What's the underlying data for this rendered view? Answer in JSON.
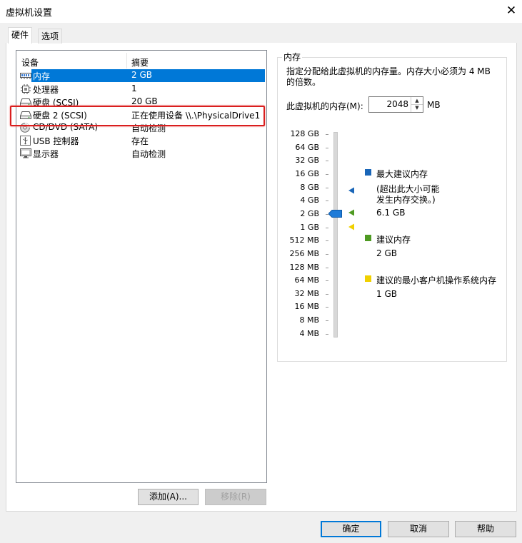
{
  "window": {
    "title": "虚拟机设置",
    "close_glyph": "✕"
  },
  "tabs": [
    {
      "label": "硬件",
      "active": true
    },
    {
      "label": "选项",
      "active": false
    }
  ],
  "device_list": {
    "col_device": "设备",
    "col_summary": "摘要",
    "rows": [
      {
        "icon": "memory-icon",
        "name": "内存",
        "summary": "2 GB",
        "selected": true
      },
      {
        "icon": "processor-icon",
        "name": "处理器",
        "summary": "1",
        "selected": false
      },
      {
        "icon": "hard-disk-icon",
        "name": "硬盘 (SCSI)",
        "summary": "20 GB",
        "selected": false
      },
      {
        "icon": "hard-disk-icon",
        "name": "硬盘 2 (SCSI)",
        "summary": "正在使用设备 \\\\.\\PhysicalDrive1",
        "selected": false,
        "highlighted": true
      },
      {
        "icon": "cd-dvd-icon",
        "name": "CD/DVD (SATA)",
        "summary": "自动检测",
        "selected": false
      },
      {
        "icon": "usb-icon",
        "name": "USB 控制器",
        "summary": "存在",
        "selected": false
      },
      {
        "icon": "display-icon",
        "name": "显示器",
        "summary": "自动检测",
        "selected": false
      }
    ]
  },
  "buttons": {
    "add": "添加(A)...",
    "remove": "移除(R)",
    "ok": "确定",
    "cancel": "取消",
    "help": "帮助"
  },
  "memory": {
    "group_title": "内存",
    "description": "指定分配给此虚拟机的内存量。内存大小必须为 4 MB 的倍数。",
    "field_label": "此虚拟机的内存(M):",
    "value": "2048",
    "unit": "MB",
    "scale_labels": [
      "128 GB",
      "64 GB",
      "32 GB",
      "16 GB",
      "8 GB",
      "4 GB",
      "2 GB",
      "1 GB",
      "512 MB",
      "256 MB",
      "128 MB",
      "64 MB",
      "32 MB",
      "16 MB",
      "8 MB",
      "4 MB"
    ],
    "current_index": 6,
    "max_recommended": {
      "title": "最大建议内存",
      "note_line1": "(超出此大小可能",
      "note_line2": "发生内存交换。)",
      "value": "6.1 GB",
      "color": "#1a66b8"
    },
    "recommended": {
      "title": "建议内存",
      "value": "2 GB",
      "color": "#4e9a22"
    },
    "min_guest": {
      "title": "建议的最小客户机操作系统内存",
      "value": "1 GB",
      "color": "#f0d000"
    }
  }
}
